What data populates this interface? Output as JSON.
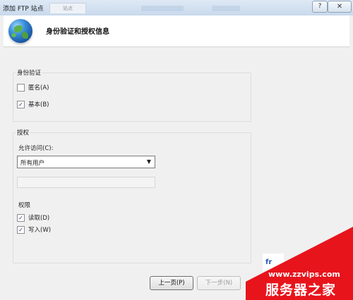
{
  "window": {
    "title": "添加 FTP 站点",
    "background_tab": "站点",
    "help_glyph": "?",
    "close_glyph": "✕"
  },
  "header": {
    "heading": "身份验证和授权信息",
    "icon": "globe-icon"
  },
  "authentication": {
    "group_label": "身份验证",
    "anonymous": {
      "label": "匿名(A)",
      "checked": false
    },
    "basic": {
      "label": "基本(B)",
      "checked": true
    }
  },
  "authorization": {
    "group_label": "授权",
    "allow_access_label": "允许访问(C):",
    "allow_access_value": "所有用户",
    "permissions_label": "权限",
    "read": {
      "label": "读取(D)",
      "checked": true
    },
    "write": {
      "label": "写入(W)",
      "checked": true
    }
  },
  "footer": {
    "prev_button": "上一页(P)",
    "next_button": "下一步(N)",
    "partial_text": "fr"
  },
  "watermark": {
    "url": "www.zzvips.com",
    "name": "服务器之家",
    "color": "#e8141c"
  },
  "colors": {
    "titlebar": "#c9d9ec",
    "dialog_bg": "#f0f0f0",
    "watermark": "#e8141c"
  }
}
